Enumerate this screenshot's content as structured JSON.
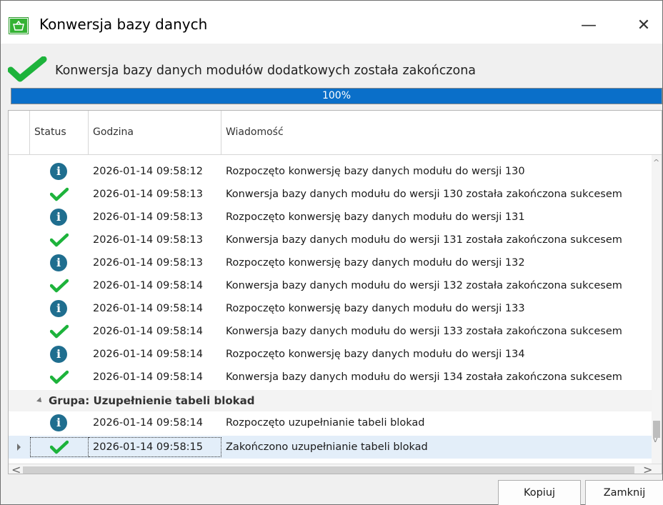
{
  "window": {
    "title": "Konwersja bazy danych",
    "minimize_glyph": "—",
    "close_glyph": "✕"
  },
  "header": {
    "message": "Konwersja bazy danych modułów dodatkowych została zakończona"
  },
  "progress": {
    "value_percent": 100,
    "label": "100%"
  },
  "grid": {
    "columns": [
      "Status",
      "Godzina",
      "Wiadomość"
    ],
    "rows": [
      {
        "status": "info",
        "time": "2026-01-14 09:58:12",
        "message": "Rozpoczęto konwersję bazy danych modułu do wersji 130"
      },
      {
        "status": "success",
        "time": "2026-01-14 09:58:13",
        "message": "Konwersja bazy danych modułu do wersji 130 została zakończona sukcesem"
      },
      {
        "status": "info",
        "time": "2026-01-14 09:58:13",
        "message": "Rozpoczęto konwersję bazy danych modułu do wersji 131"
      },
      {
        "status": "success",
        "time": "2026-01-14 09:58:13",
        "message": "Konwersja bazy danych modułu do wersji 131 została zakończona sukcesem"
      },
      {
        "status": "info",
        "time": "2026-01-14 09:58:13",
        "message": "Rozpoczęto konwersję bazy danych modułu do wersji 132"
      },
      {
        "status": "success",
        "time": "2026-01-14 09:58:14",
        "message": "Konwersja bazy danych modułu do wersji 132 została zakończona sukcesem"
      },
      {
        "status": "info",
        "time": "2026-01-14 09:58:14",
        "message": "Rozpoczęto konwersję bazy danych modułu do wersji 133"
      },
      {
        "status": "success",
        "time": "2026-01-14 09:58:14",
        "message": "Konwersja bazy danych modułu do wersji 133 została zakończona sukcesem"
      },
      {
        "status": "info",
        "time": "2026-01-14 09:58:14",
        "message": "Rozpoczęto konwersję bazy danych modułu do wersji 134"
      },
      {
        "status": "success",
        "time": "2026-01-14 09:58:14",
        "message": "Konwersja bazy danych modułu do wersji 134 została zakończona sukcesem"
      }
    ],
    "group": {
      "label": "Grupa: Uzupełnienie tabeli blokad",
      "rows": [
        {
          "status": "info",
          "time": "2026-01-14 09:58:14",
          "message": "Rozpoczęto uzupełnianie tabeli blokad"
        },
        {
          "status": "success",
          "time": "2026-01-14 09:58:15",
          "message": "Zakończono uzupełnianie tabeli blokad"
        }
      ]
    },
    "scroll_up": "^",
    "scroll_down": "v",
    "scroll_left": "<",
    "scroll_right": ">"
  },
  "footer": {
    "copy_label": "Kopiuj",
    "close_label": "Zamknij"
  },
  "colors": {
    "accent": "#0a6fc9",
    "success": "#1db33b",
    "info": "#1f6e8f",
    "app_icon": "#34b233"
  }
}
